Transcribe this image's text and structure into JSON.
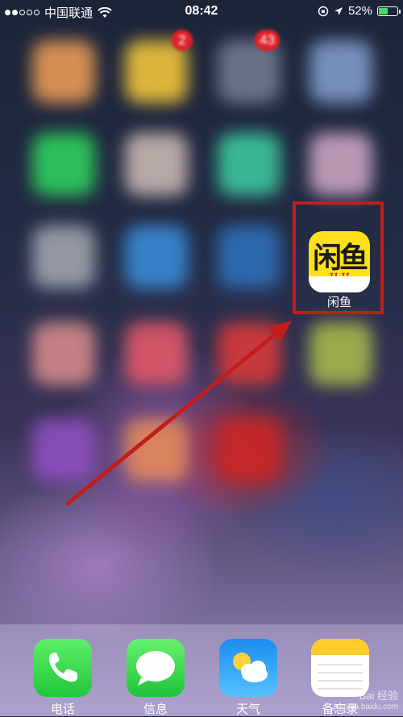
{
  "status_bar": {
    "carrier": "中国联通",
    "time": "08:42",
    "battery_percent": "52%",
    "battery_level": 0.52,
    "signal_bars_filled": 2,
    "signal_bars_total": 5
  },
  "home_badges": {
    "badge_1": "2",
    "badge_2": "43"
  },
  "highlighted_app": {
    "logo_text": "闲鱼",
    "logo_sub": "11.11",
    "label": "闲鱼",
    "brand_color": "#ffe11a"
  },
  "annotation": {
    "box_color": "#c21d1d",
    "arrow_color": "#c21d1d"
  },
  "dock": {
    "items": [
      {
        "label": "电话",
        "icon": "phone-icon"
      },
      {
        "label": "信息",
        "icon": "messages-icon"
      },
      {
        "label": "天气",
        "icon": "weather-icon"
      },
      {
        "label": "备忘录",
        "icon": "notes-icon"
      }
    ]
  },
  "watermark": {
    "line1": "Bai 经验",
    "line2": "jingyan.baidu.com"
  }
}
